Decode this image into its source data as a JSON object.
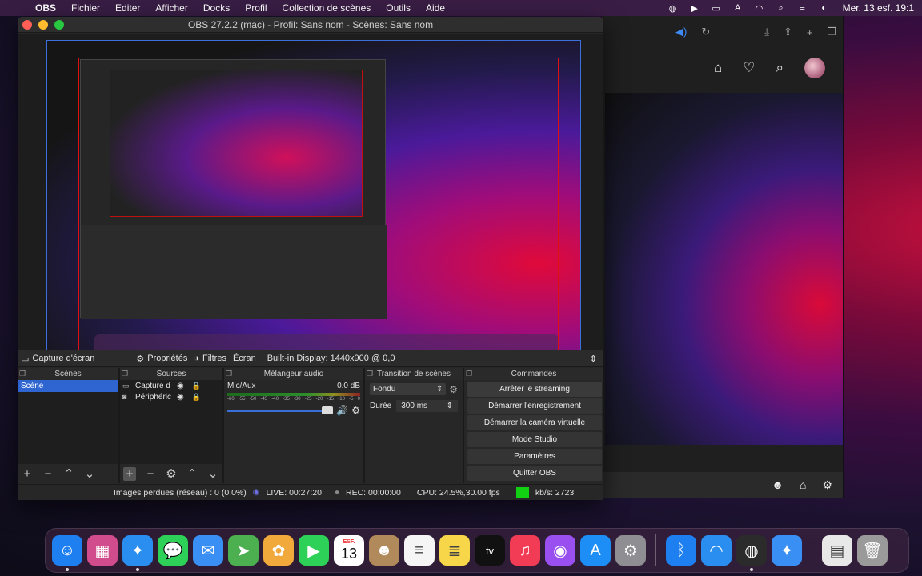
{
  "menubar": {
    "apple": "",
    "items": [
      "OBS",
      "Fichier",
      "Editer",
      "Afficher",
      "Docks",
      "Profil",
      "Collection de scènes",
      "Outils",
      "Aide"
    ],
    "clock": "Mer. 13 esf.  19:1"
  },
  "window": {
    "title": "OBS 27.2.2 (mac) - Profil: Sans nom - Scènes: Sans nom"
  },
  "source_toolbar": {
    "source_name": "Capture d'écran",
    "properties": "Propriétés",
    "filters": "Filtres",
    "screen": "Écran",
    "display": "Built-in Display: 1440x900 @ 0,0"
  },
  "docks": {
    "scenes": {
      "title": "Scènes",
      "items": [
        "Scène"
      ]
    },
    "sources": {
      "title": "Sources",
      "items": [
        {
          "name": "Capture d",
          "icon": "monitor-icon"
        },
        {
          "name": "Périphéric",
          "icon": "camera-icon"
        }
      ]
    },
    "mixer": {
      "title": "Mélangeur audio",
      "channel": "Mic/Aux",
      "level": "0.0 dB",
      "scale": [
        "-60",
        "-55",
        "-50",
        "-45",
        "-40",
        "-35",
        "-30",
        "-25",
        "-20",
        "-15",
        "-10",
        "-5",
        "0"
      ]
    },
    "transition": {
      "title": "Transition de scènes",
      "type": "Fondu",
      "duration_label": "Durée",
      "duration_value": "300 ms"
    },
    "controls": {
      "title": "Commandes",
      "buttons": [
        "Arrêter le streaming",
        "Démarrer l'enregistrement",
        "Démarrer la caméra virtuelle",
        "Mode Studio",
        "Paramètres",
        "Quitter OBS"
      ]
    }
  },
  "status": {
    "dropped": "Images perdues (réseau) : 0 (0.0%)",
    "live": "LIVE: 00:27:20",
    "rec": "REC: 00:00:00",
    "cpu": "CPU: 24.5%,30.00 fps",
    "bitrate": "kb/s: 2723",
    "health_color": "#12d012"
  },
  "calendar": {
    "month": "ESF.",
    "day": "13"
  },
  "dock_apps": [
    {
      "name": "finder-icon",
      "color": "#1e7ff0",
      "glyph": "☺"
    },
    {
      "name": "launchpad-icon",
      "color": "#d04c8c",
      "glyph": "▦"
    },
    {
      "name": "safari-icon",
      "color": "#2a8df0",
      "glyph": "✦"
    },
    {
      "name": "messages-icon",
      "color": "#2ed158",
      "glyph": "💬"
    },
    {
      "name": "mail-icon",
      "color": "#3a8ff5",
      "glyph": "✉"
    },
    {
      "name": "maps-icon",
      "color": "#4caf50",
      "glyph": "➤"
    },
    {
      "name": "photos-icon",
      "color": "#f2a93b",
      "glyph": "✿"
    },
    {
      "name": "facetime-icon",
      "color": "#2ed158",
      "glyph": "▶"
    },
    {
      "name": "calendar-icon",
      "color": "#ffffff",
      "glyph": ""
    },
    {
      "name": "contacts-icon",
      "color": "#b08a5a",
      "glyph": "☻"
    },
    {
      "name": "reminders-icon",
      "color": "#f5f5f5",
      "glyph": "≡"
    },
    {
      "name": "notes-icon",
      "color": "#f7d64a",
      "glyph": "≣"
    },
    {
      "name": "appletv-icon",
      "color": "#111111",
      "glyph": "tv"
    },
    {
      "name": "music-icon",
      "color": "#f23c55",
      "glyph": "♫"
    },
    {
      "name": "podcasts-icon",
      "color": "#9a4ff0",
      "glyph": "◉"
    },
    {
      "name": "appstore-icon",
      "color": "#1d8ef5",
      "glyph": "A"
    },
    {
      "name": "settings-icon",
      "color": "#8e8e93",
      "glyph": "⚙"
    },
    {
      "name": "bluetooth-icon",
      "color": "#1e7ff0",
      "glyph": "ᛒ"
    },
    {
      "name": "wifi-icon",
      "color": "#2a8df0",
      "glyph": "◠"
    },
    {
      "name": "obs-icon",
      "color": "#2b2b2b",
      "glyph": "◍"
    },
    {
      "name": "safari-tech-icon",
      "color": "#3a8ff5",
      "glyph": "✦"
    },
    {
      "name": "document-icon",
      "color": "#e8e8e8",
      "glyph": "▤"
    },
    {
      "name": "trash-icon",
      "color": "#9a9a9a",
      "glyph": "🗑"
    }
  ]
}
